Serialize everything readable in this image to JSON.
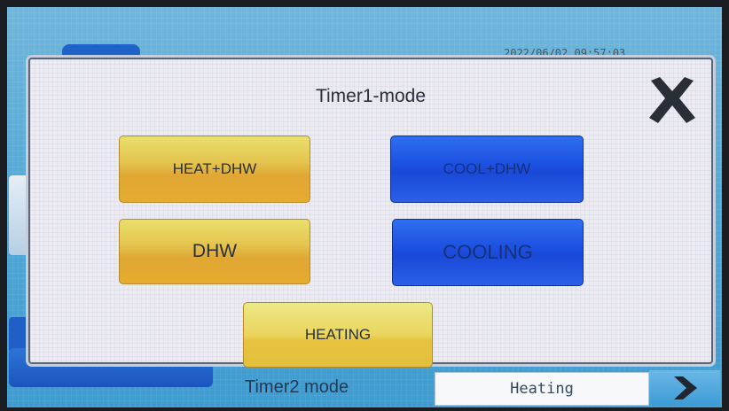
{
  "header": {
    "datetime": "2022/06/02 09:57:03"
  },
  "dialog": {
    "title": "Timer1-mode",
    "buttons": {
      "heat_dhw": "HEAT+DHW",
      "cool_dhw": "COOL+DHW",
      "dhw": "DHW",
      "cooling": "COOLING",
      "heating": "HEATING"
    }
  },
  "footer": {
    "timer2_label": "Timer2 mode",
    "timer2_value": "Heating"
  },
  "icons": {
    "close": "close-icon",
    "next": "chevron-right-icon"
  },
  "colors": {
    "yellow_button": "#e4c44e",
    "blue_button": "#1b4fe0",
    "background": "#4ea7d6"
  }
}
